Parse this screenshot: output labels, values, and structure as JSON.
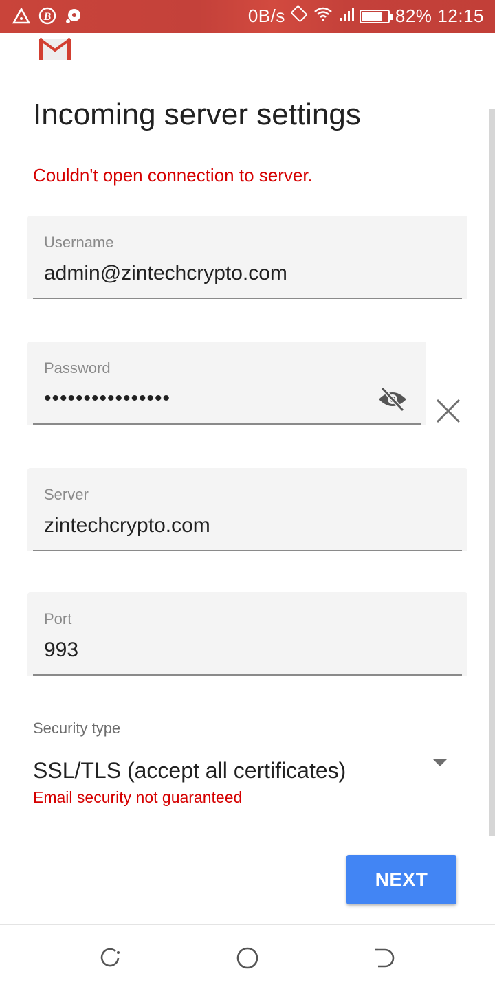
{
  "status_bar": {
    "net_speed": "0B/s",
    "battery_percent": "82%",
    "battery_level": 0.82,
    "time": "12:15",
    "icons": [
      "alert-triangle-icon",
      "b-circle-icon",
      "sync-icon",
      "rotate-icon",
      "wifi-icon",
      "signal-icon",
      "battery-charging-icon"
    ]
  },
  "app": {
    "logo": "gmail-logo"
  },
  "page": {
    "title": "Incoming server settings",
    "error": "Couldn't open connection to server."
  },
  "fields": {
    "username": {
      "label": "Username",
      "value": "admin@zintechcrypto.com"
    },
    "password": {
      "label": "Password",
      "value": "••••••••••••••••"
    },
    "server": {
      "label": "Server",
      "value": "zintechcrypto.com"
    },
    "port": {
      "label": "Port",
      "value": "993"
    }
  },
  "security": {
    "label": "Security type",
    "value": "SSL/TLS (accept all certificates)",
    "warning": "Email security not guaranteed"
  },
  "actions": {
    "next_label": "NEXT"
  },
  "colors": {
    "status_bar": "#c4413a",
    "error": "#d50000",
    "primary_button": "#4285f4",
    "field_bg": "#f4f4f4"
  }
}
